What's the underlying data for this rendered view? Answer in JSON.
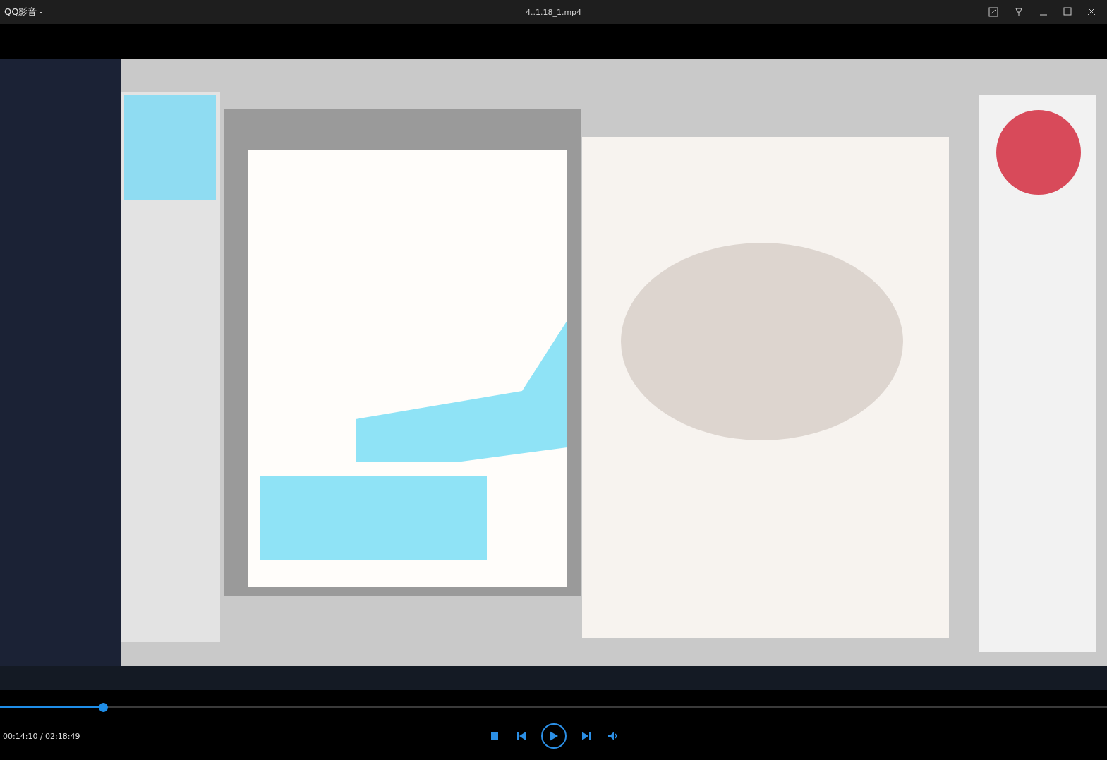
{
  "player": {
    "title": "QQ影音",
    "file_name": "4..1.18_1.mp4"
  },
  "progress": {
    "level": 0.093
  },
  "time": "00:14:10 / 02:18:49",
  "controls": [
    {
      "kind": "stop"
    },
    {
      "kind": "previous"
    },
    {
      "kind": "play"
    },
    {
      "kind": "next"
    },
    {
      "kind": "volume"
    }
  ]
}
